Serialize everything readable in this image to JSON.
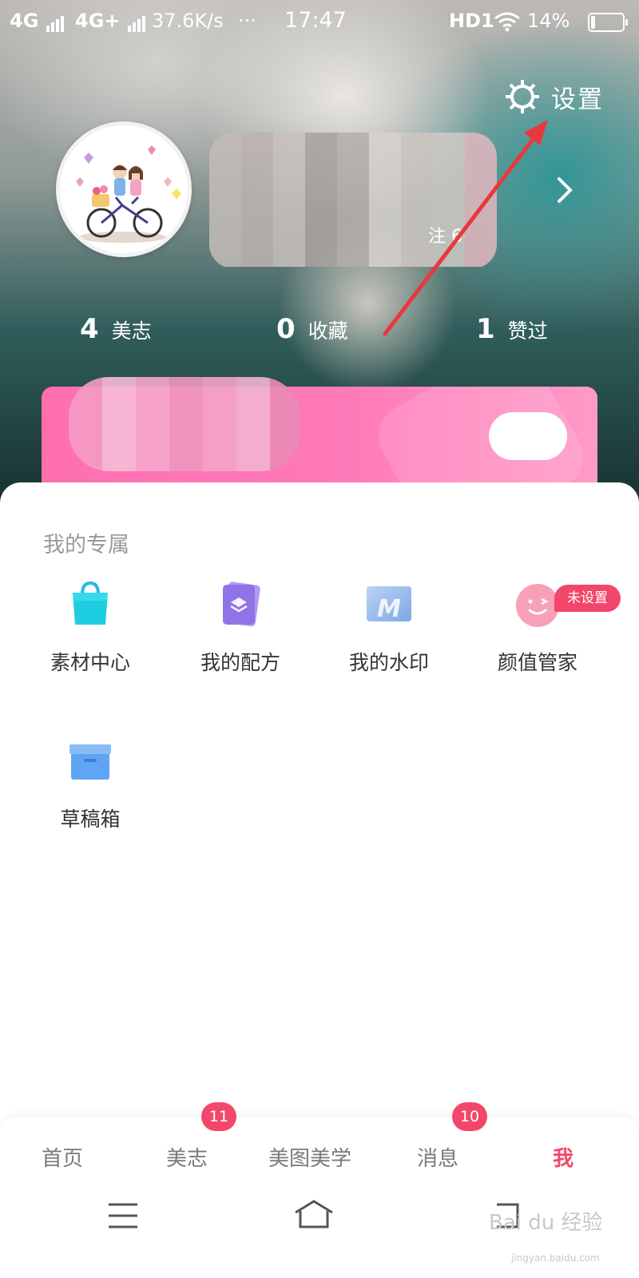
{
  "status_bar": {
    "carrier1": "4G",
    "carrier2": "4G+",
    "speed": "37.6K/s",
    "dots": "···",
    "time": "17:47",
    "hd": "HD1",
    "battery_pct": "14%",
    "battery_level": 0.14
  },
  "header": {
    "settings_label": "设置",
    "follow_text": "注 6"
  },
  "stats": [
    {
      "num": "4",
      "label": "美志"
    },
    {
      "num": "0",
      "label": "收藏"
    },
    {
      "num": "1",
      "label": "赞过"
    }
  ],
  "section": {
    "title": "我的专属"
  },
  "tools": [
    {
      "label": "素材中心",
      "icon": "shopping-bag-icon"
    },
    {
      "label": "我的配方",
      "icon": "layers-card-icon"
    },
    {
      "label": "我的水印",
      "icon": "watermark-m-icon"
    },
    {
      "label": "颜值管家",
      "icon": "wink-face-icon",
      "badge": "未设置"
    },
    {
      "label": "草稿箱",
      "icon": "draft-box-icon"
    }
  ],
  "bottom_nav": [
    {
      "label": "首页"
    },
    {
      "label": "美志",
      "count": "11"
    },
    {
      "label": "美图美学"
    },
    {
      "label": "消息",
      "count": "10"
    },
    {
      "label": "我",
      "active": true
    }
  ],
  "watermark": {
    "text": "Bai du 经验",
    "url_text": "jingyan.baidu.com"
  },
  "colors": {
    "accent": "#f2476a",
    "card_pink": "#ff7ab8",
    "arrow_red": "#e8383d"
  }
}
